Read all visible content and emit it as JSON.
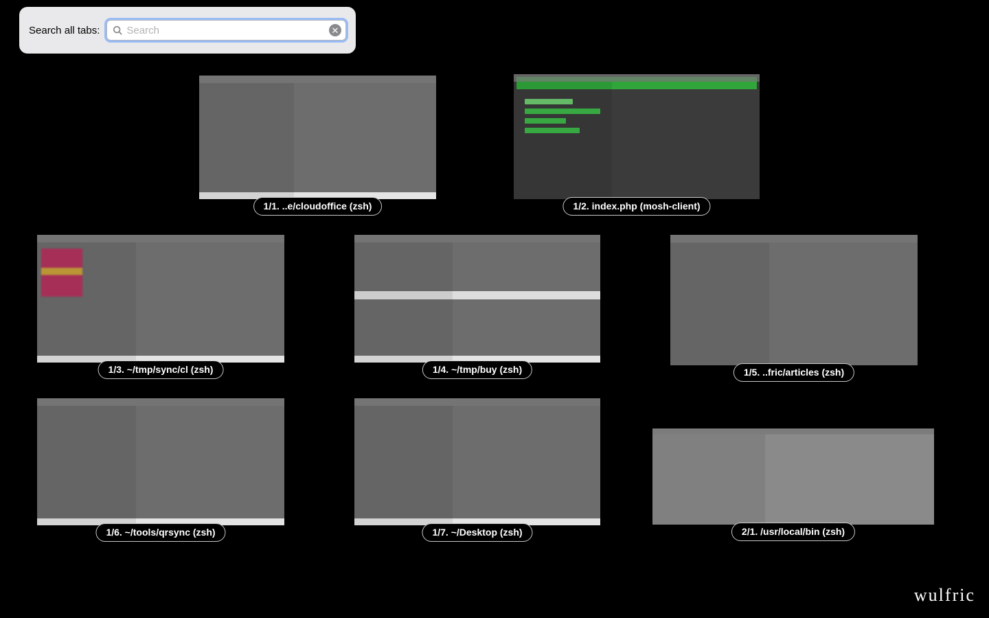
{
  "search": {
    "label": "Search all tabs:",
    "placeholder": "Search",
    "value": ""
  },
  "watermark": "wulfric",
  "tabs": [
    {
      "label": "1/1. ..e/cloudoffice (zsh)"
    },
    {
      "label": "1/2. index.php (mosh-client)"
    },
    {
      "label": "1/3. ~/tmp/sync/cl (zsh)"
    },
    {
      "label": "1/4. ~/tmp/buy (zsh)"
    },
    {
      "label": "1/5. ..fric/articles (zsh)"
    },
    {
      "label": "1/6. ~/tools/qrsync (zsh)"
    },
    {
      "label": "1/7. ~/Desktop (zsh)"
    },
    {
      "label": "2/1. /usr/local/bin (zsh)"
    }
  ]
}
